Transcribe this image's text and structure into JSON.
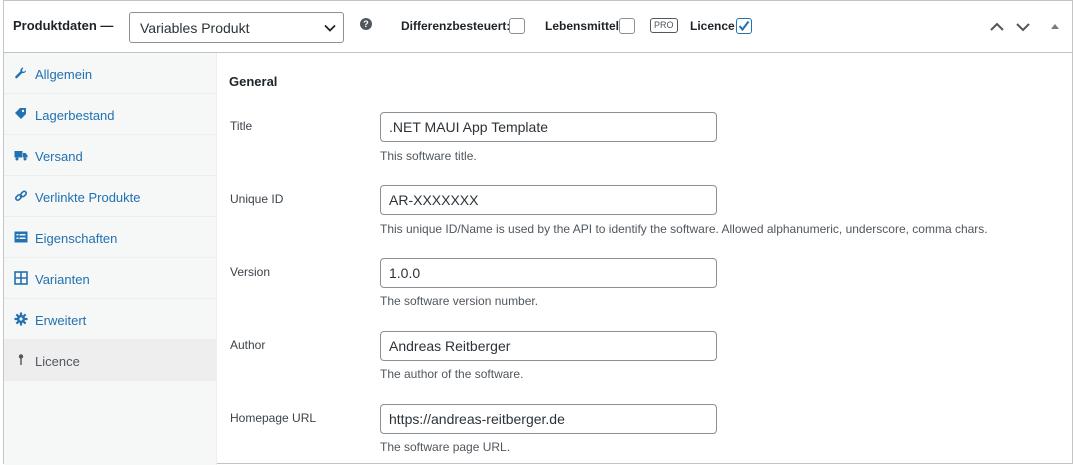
{
  "header": {
    "title": "Produktdaten —",
    "product_type": "Variables Produkt",
    "help": "?",
    "differenzbesteuert_label": "Differenzbesteuert:",
    "lebensmittel_label": "Lebensmittel:",
    "pro_badge": "PRO",
    "licence_label": "Licence:",
    "licence_checked": true
  },
  "sidebar": {
    "items": [
      {
        "label": "Allgemein",
        "icon": "wrench-icon"
      },
      {
        "label": "Lagerbestand",
        "icon": "tag-icon"
      },
      {
        "label": "Versand",
        "icon": "truck-icon"
      },
      {
        "label": "Verlinkte Produkte",
        "icon": "link-icon"
      },
      {
        "label": "Eigenschaften",
        "icon": "list-icon"
      },
      {
        "label": "Varianten",
        "icon": "grid-icon"
      },
      {
        "label": "Erweitert",
        "icon": "gear-icon"
      },
      {
        "label": "Licence",
        "icon": "pin-icon",
        "active": true
      }
    ]
  },
  "main": {
    "section_title": "General",
    "fields": [
      {
        "label": "Title",
        "value": ".NET MAUI App Template",
        "description": "This software title."
      },
      {
        "label": "Unique ID",
        "value": "AR-XXXXXXX",
        "description": "This unique ID/Name is used by the API to identify the software. Allowed alphanumeric, underscore, comma chars."
      },
      {
        "label": "Version",
        "value": "1.0.0",
        "description": "The software version number."
      },
      {
        "label": "Author",
        "value": "Andreas Reitberger",
        "description": "The author of the software."
      },
      {
        "label": "Homepage URL",
        "value": "https://andreas-reitberger.de",
        "description": "The software page URL."
      }
    ]
  }
}
